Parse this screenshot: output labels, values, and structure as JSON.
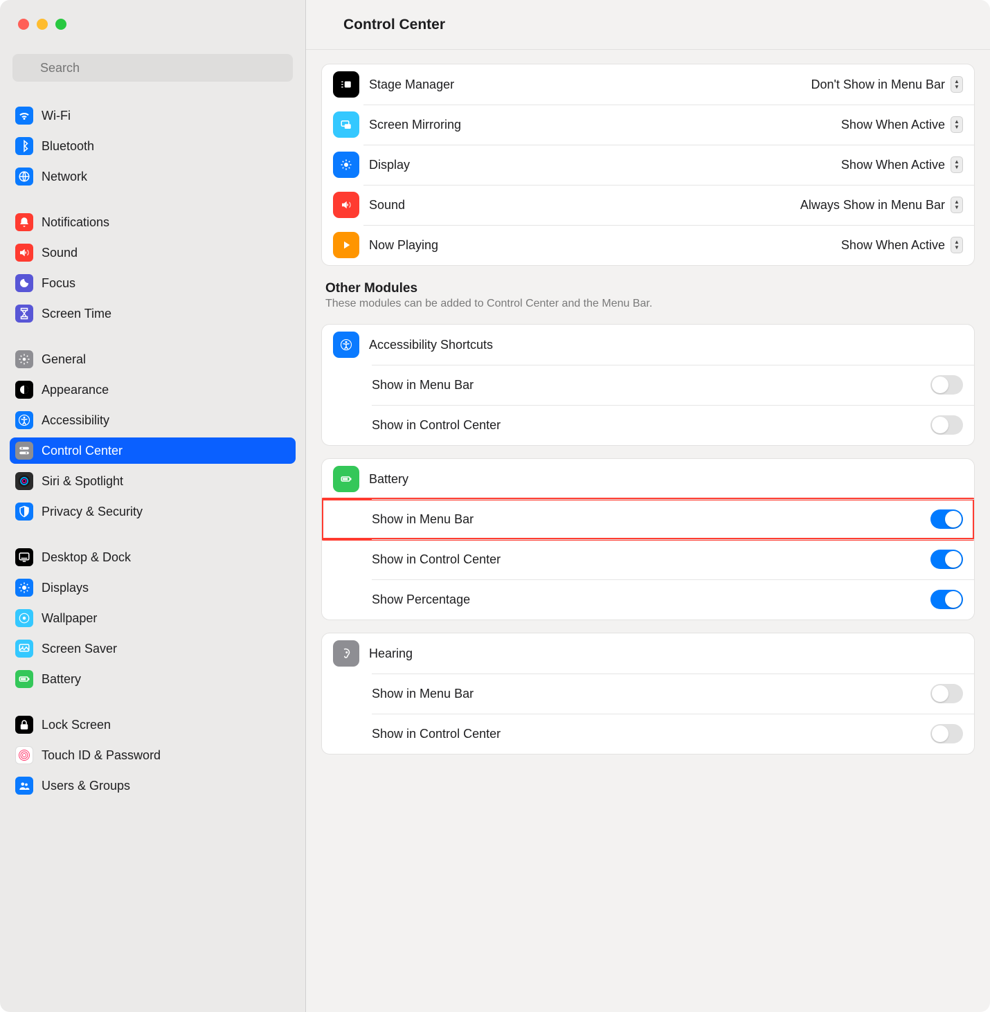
{
  "header": {
    "title": "Control Center"
  },
  "search": {
    "placeholder": "Search"
  },
  "sidebar": {
    "groups": [
      {
        "items": [
          {
            "id": "wifi",
            "label": "Wi-Fi",
            "bg": "#0a7aff"
          },
          {
            "id": "bluetooth",
            "label": "Bluetooth",
            "bg": "#0a7aff"
          },
          {
            "id": "network",
            "label": "Network",
            "bg": "#0a7aff"
          }
        ]
      },
      {
        "items": [
          {
            "id": "notifications",
            "label": "Notifications",
            "bg": "#ff3b30"
          },
          {
            "id": "sound",
            "label": "Sound",
            "bg": "#ff3b30"
          },
          {
            "id": "focus",
            "label": "Focus",
            "bg": "#5856d6"
          },
          {
            "id": "screentime",
            "label": "Screen Time",
            "bg": "#5856d6"
          }
        ]
      },
      {
        "items": [
          {
            "id": "general",
            "label": "General",
            "bg": "#8e8e93"
          },
          {
            "id": "appearance",
            "label": "Appearance",
            "bg": "#000000"
          },
          {
            "id": "accessibility",
            "label": "Accessibility",
            "bg": "#0a7aff"
          },
          {
            "id": "control-center",
            "label": "Control Center",
            "bg": "#8e8e93",
            "selected": true
          },
          {
            "id": "siri",
            "label": "Siri & Spotlight",
            "bg": "#2b2b2b"
          },
          {
            "id": "privacy",
            "label": "Privacy & Security",
            "bg": "#0a7aff"
          }
        ]
      },
      {
        "items": [
          {
            "id": "desktop-dock",
            "label": "Desktop & Dock",
            "bg": "#000000"
          },
          {
            "id": "displays",
            "label": "Displays",
            "bg": "#0a7aff"
          },
          {
            "id": "wallpaper",
            "label": "Wallpaper",
            "bg": "#34c8ff"
          },
          {
            "id": "screensaver",
            "label": "Screen Saver",
            "bg": "#34c8ff"
          },
          {
            "id": "battery",
            "label": "Battery",
            "bg": "#34c759"
          }
        ]
      },
      {
        "items": [
          {
            "id": "lock-screen",
            "label": "Lock Screen",
            "bg": "#000000"
          },
          {
            "id": "touchid",
            "label": "Touch ID & Password",
            "bg": "#ffffff"
          },
          {
            "id": "users",
            "label": "Users & Groups",
            "bg": "#0a7aff"
          }
        ]
      }
    ]
  },
  "top_rows": [
    {
      "id": "stage-manager",
      "label": "Stage Manager",
      "value": "Don't Show in Menu Bar",
      "bg": "#000000"
    },
    {
      "id": "screen-mirroring",
      "label": "Screen Mirroring",
      "value": "Show When Active",
      "bg": "#34c8ff"
    },
    {
      "id": "display",
      "label": "Display",
      "value": "Show When Active",
      "bg": "#0a7aff"
    },
    {
      "id": "sound",
      "label": "Sound",
      "value": "Always Show in Menu Bar",
      "bg": "#ff3b30"
    },
    {
      "id": "now-playing",
      "label": "Now Playing",
      "value": "Show When Active",
      "bg": "#ff9500"
    }
  ],
  "other_modules": {
    "title": "Other Modules",
    "subtitle": "These modules can be added to Control Center and the Menu Bar."
  },
  "modules": [
    {
      "id": "accessibility-shortcuts",
      "label": "Accessibility Shortcuts",
      "bg": "#0a7aff",
      "settings": [
        {
          "id": "menubar",
          "label": "Show in Menu Bar",
          "on": false
        },
        {
          "id": "cc",
          "label": "Show in Control Center",
          "on": false
        }
      ]
    },
    {
      "id": "battery",
      "label": "Battery",
      "bg": "#34c759",
      "settings": [
        {
          "id": "menubar",
          "label": "Show in Menu Bar",
          "on": true,
          "highlight": true
        },
        {
          "id": "cc",
          "label": "Show in Control Center",
          "on": true
        },
        {
          "id": "percent",
          "label": "Show Percentage",
          "on": true
        }
      ]
    },
    {
      "id": "hearing",
      "label": "Hearing",
      "bg": "#8e8e93",
      "settings": [
        {
          "id": "menubar",
          "label": "Show in Menu Bar",
          "on": false
        },
        {
          "id": "cc",
          "label": "Show in Control Center",
          "on": false
        }
      ]
    }
  ]
}
